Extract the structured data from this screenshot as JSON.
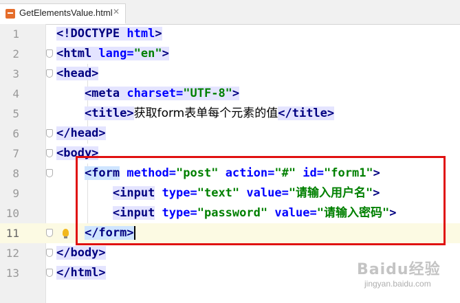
{
  "tab": {
    "filename": "GetElementsValue.html",
    "close_glyph": "✕",
    "icon": "html-file-icon"
  },
  "watermark": {
    "logo": "Baidu经验",
    "url": "jingyan.baidu.com"
  },
  "colors": {
    "tag": "#000080",
    "attr": "#0000ff",
    "value": "#008000",
    "highlight_box": "#e01010",
    "current_line": "#fcfae3"
  },
  "lines": [
    {
      "num": "1"
    },
    {
      "num": "2"
    },
    {
      "num": "3"
    },
    {
      "num": "4"
    },
    {
      "num": "5"
    },
    {
      "num": "6"
    },
    {
      "num": "7"
    },
    {
      "num": "8"
    },
    {
      "num": "9"
    },
    {
      "num": "10"
    },
    {
      "num": "11"
    },
    {
      "num": "12"
    },
    {
      "num": "13"
    }
  ],
  "code": {
    "l1": {
      "a": "<!DOCTYPE ",
      "b": "html",
      "c": ">"
    },
    "l2": {
      "a": "<html ",
      "b": "lang=",
      "c": "\"en\"",
      "d": ">"
    },
    "l3": {
      "a": "<head>"
    },
    "l4": {
      "a": "<meta ",
      "b": "charset=",
      "c": "\"UTF-8\"",
      "d": ">"
    },
    "l5": {
      "a": "<title>",
      "b": "获取form表单每个元素的值",
      "c": "</title>"
    },
    "l6": {
      "a": "</head>"
    },
    "l7": {
      "a": "<body>"
    },
    "l8": {
      "a": "<form",
      "b": " method=",
      "c": "\"post\"",
      "d": " action=",
      "e": "\"#\"",
      "f": " id=",
      "g": "\"form1\"",
      "h": ">"
    },
    "l9": {
      "a": "<input",
      "b": " type=",
      "c": "\"text\"",
      "d": " value=",
      "e": "\"请输入用户名\"",
      "f": ">"
    },
    "l10": {
      "a": "<input",
      "b": " type=",
      "c": "\"password\"",
      "d": " value=",
      "e": "\"请输入密码\"",
      "f": ">"
    },
    "l11": {
      "a": "</form>"
    },
    "l12": {
      "a": "</body>"
    },
    "l13": {
      "a": "</html>"
    }
  }
}
